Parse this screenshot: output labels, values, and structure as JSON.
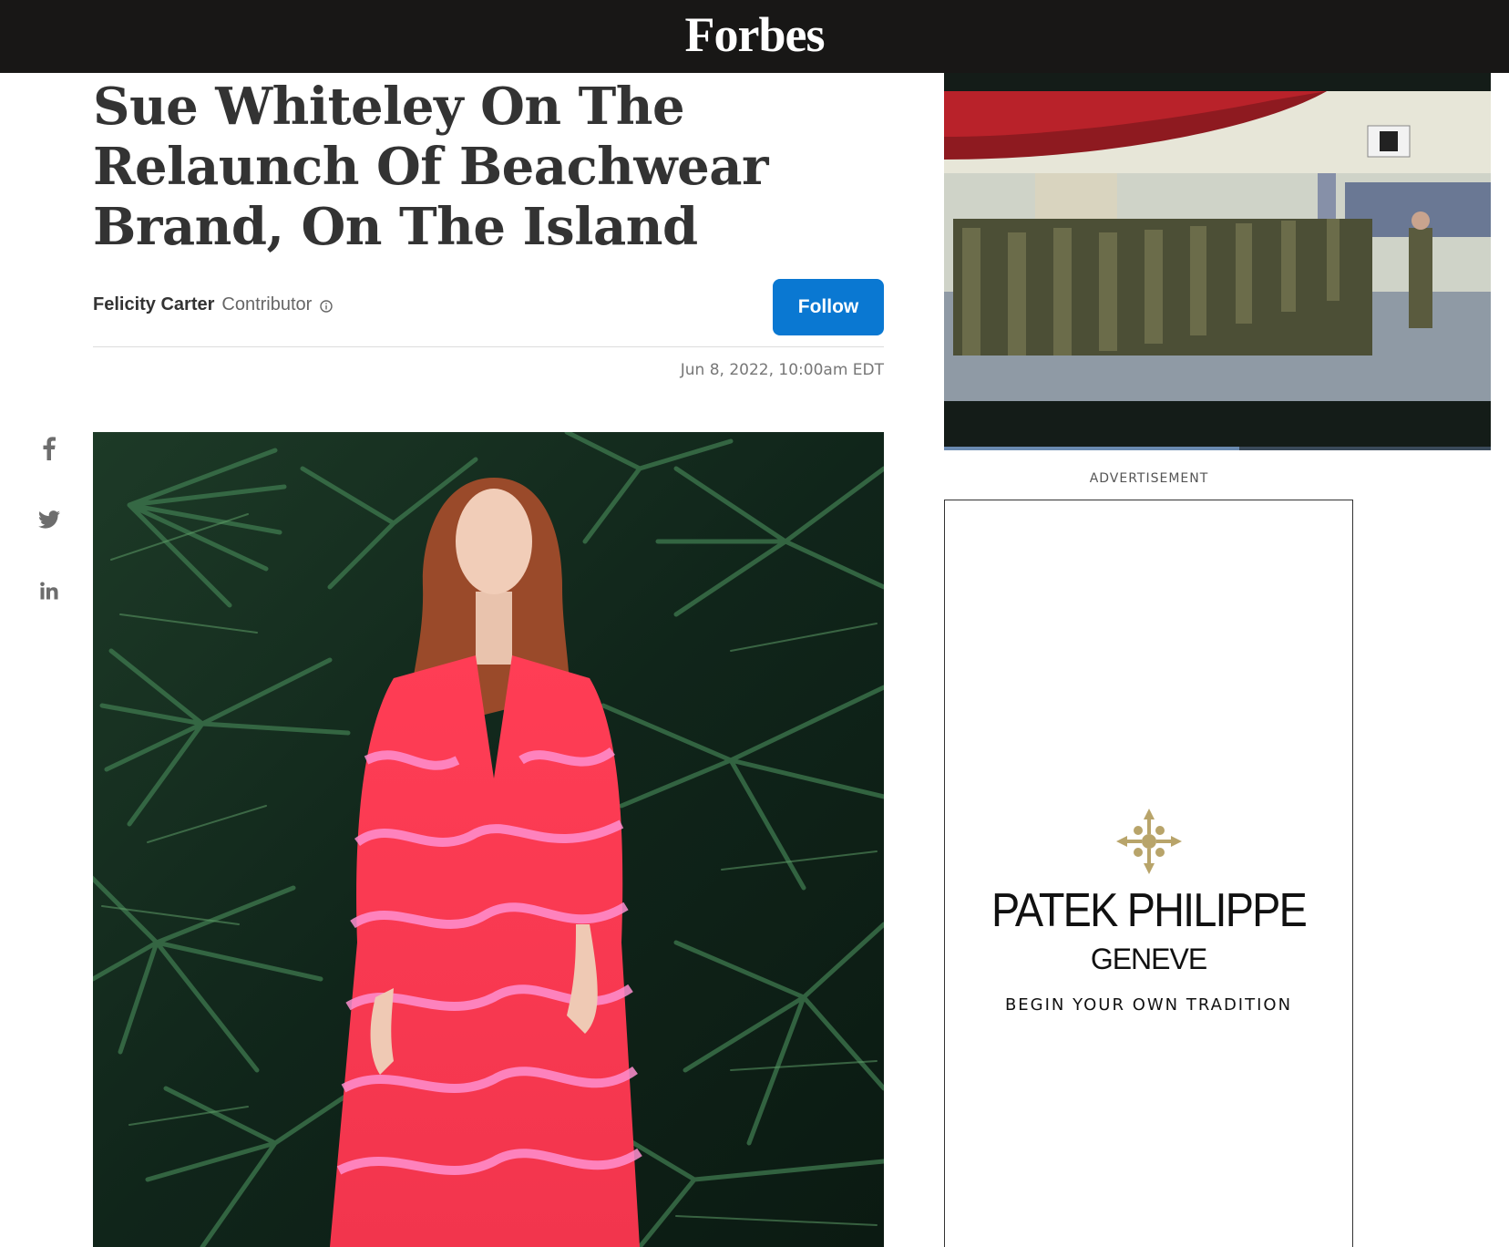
{
  "header": {
    "logo_text": "Forbes",
    "background": "#181716"
  },
  "article": {
    "headline": "Sue Whiteley On The Relaunch Of Beachwear Brand, On The Island",
    "author": "Felicity Carter",
    "role": "Contributor",
    "role_info_icon": "info-icon",
    "follow_label": "Follow",
    "date": "Jun 8, 2022, 10:00am EDT",
    "accent": "#0a78d2"
  },
  "share": {
    "items": [
      {
        "name": "facebook",
        "icon": "facebook-icon"
      },
      {
        "name": "twitter",
        "icon": "twitter-icon"
      },
      {
        "name": "linkedin",
        "icon": "linkedin-icon"
      }
    ]
  },
  "video": {
    "progress_fraction": 0.54
  },
  "ad": {
    "label": "ADVERTISEMENT",
    "brand": "PATEK PHILIPPE",
    "city": "GENEVE",
    "tagline": "BEGIN YOUR OWN TRADITION",
    "emblem_color": "#b8a46a"
  }
}
